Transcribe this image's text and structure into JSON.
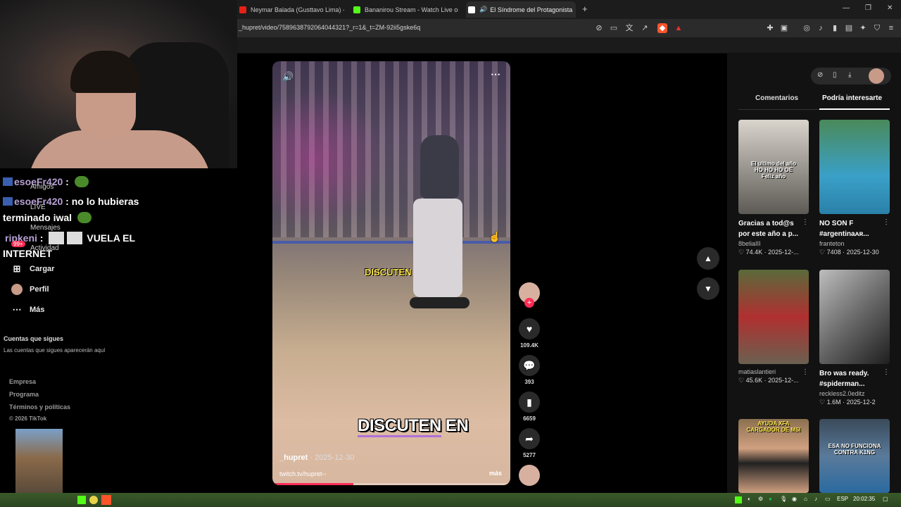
{
  "browser": {
    "tabs": [
      {
        "title": "Neymar Balada (Gusttavo Lima) - Yo",
        "fav_color": "#e62117",
        "active": false
      },
      {
        "title": "Bananirou Stream - Watch Live on Ki",
        "fav_color": "#53fc18",
        "active": false
      },
      {
        "title": "El Síndrome del Protagonista",
        "fav_color": "#ffffff",
        "active": true
      }
    ],
    "close_tab": "✕",
    "new_tab": "+",
    "url": "_hupret/video/7589638792064044321?_r=1&_t=ZM-92ii5gske6q",
    "window_controls": [
      "—",
      "❐",
      "✕"
    ]
  },
  "chat": [
    {
      "user": "esoeFr420",
      "sep": ":",
      "msg": ""
    },
    {
      "user": "esoeFr420",
      "sep": ":",
      "msg": "no lo hubieras"
    },
    {
      "user": "",
      "sep": "",
      "msg": "terminado iwal"
    },
    {
      "user": "ripkeni",
      "sep": ":",
      "msg": "VUELA EL"
    },
    {
      "user": "",
      "sep": "",
      "msg": "INTERNET"
    }
  ],
  "nav_ghost": {
    "amigos": "Amigos",
    "live": "LIVE",
    "mensajes": "Mensajes",
    "actividad": "Actividad",
    "badge": "99+"
  },
  "nav": {
    "upload": "Cargar",
    "profile": "Perfil",
    "more": "Más"
  },
  "following": {
    "title": "Cuentas que sigues",
    "desc": "Las cuentas que sigues aparecerán aquí"
  },
  "footer": {
    "links": [
      "Empresa",
      "Programa",
      "Términos y políticas"
    ],
    "copyright": "© 2026 TikTok"
  },
  "video": {
    "caption_top": "DISCUTEN",
    "caption_main": "DISCUTEN",
    "caption_main_suffix": "EN",
    "author": "_hupret",
    "date": "· 2025-12-30",
    "desc": "twitch.tv/hupret--",
    "more": "más",
    "progress": 0.34
  },
  "actions": {
    "likes": "109.4K",
    "comments": "393",
    "saves": "6659",
    "shares": "5277"
  },
  "right_panel": {
    "tabs": [
      "Comentarios",
      "Podría interesarte"
    ],
    "cards": [
      {
        "thumb_text": "El ultimo del año\nHO HO HO OE\nFeliz año",
        "title": "Gracias a tod@s por este año a p...",
        "author": "8beliaIII",
        "likes": "♡ 74.4K",
        "date": "· 2025-12-...",
        "colors": [
          "#d9d4cc",
          "#5d5a55"
        ]
      },
      {
        "thumb_text": "",
        "title": "NO SON F #argentinaᴀʀ...",
        "author": "franteton",
        "likes": "♡ 7408",
        "date": "· 2025-12-30",
        "colors": [
          "#3aa0c8",
          "#6b8f3a"
        ]
      },
      {
        "thumb_text": "",
        "title": "",
        "author": "matiaslantieri",
        "likes": "♡ 45.6K",
        "date": "· 2025-12-...",
        "colors": [
          "#6b6040",
          "#b03030"
        ]
      },
      {
        "thumb_text": "",
        "title": "Bro was ready. #spiderman...",
        "author": "reckless2.0editz",
        "likes": "♡ 1.6M",
        "date": "· 2025-12-2",
        "colors": [
          "#9a9a9a",
          "#2a2a2a"
        ]
      },
      {
        "thumb_text": "AYUDA XFA\nCARGADOR DE MSI",
        "title": "",
        "author": "",
        "likes": "",
        "date": "",
        "colors": [
          "#a08060",
          "#222"
        ]
      },
      {
        "thumb_text": "ESA NO FUNCIONA\nCONTRA K1NG",
        "title": "",
        "author": "",
        "likes": "",
        "date": "",
        "colors": [
          "#4a5a6a",
          "#2a6aa0"
        ]
      }
    ]
  },
  "taskbar": {
    "lang": "ESP",
    "time": "20:02:35"
  },
  "colors": {
    "accent": "#fe2c55",
    "chat_user": "#b7a2d6"
  }
}
